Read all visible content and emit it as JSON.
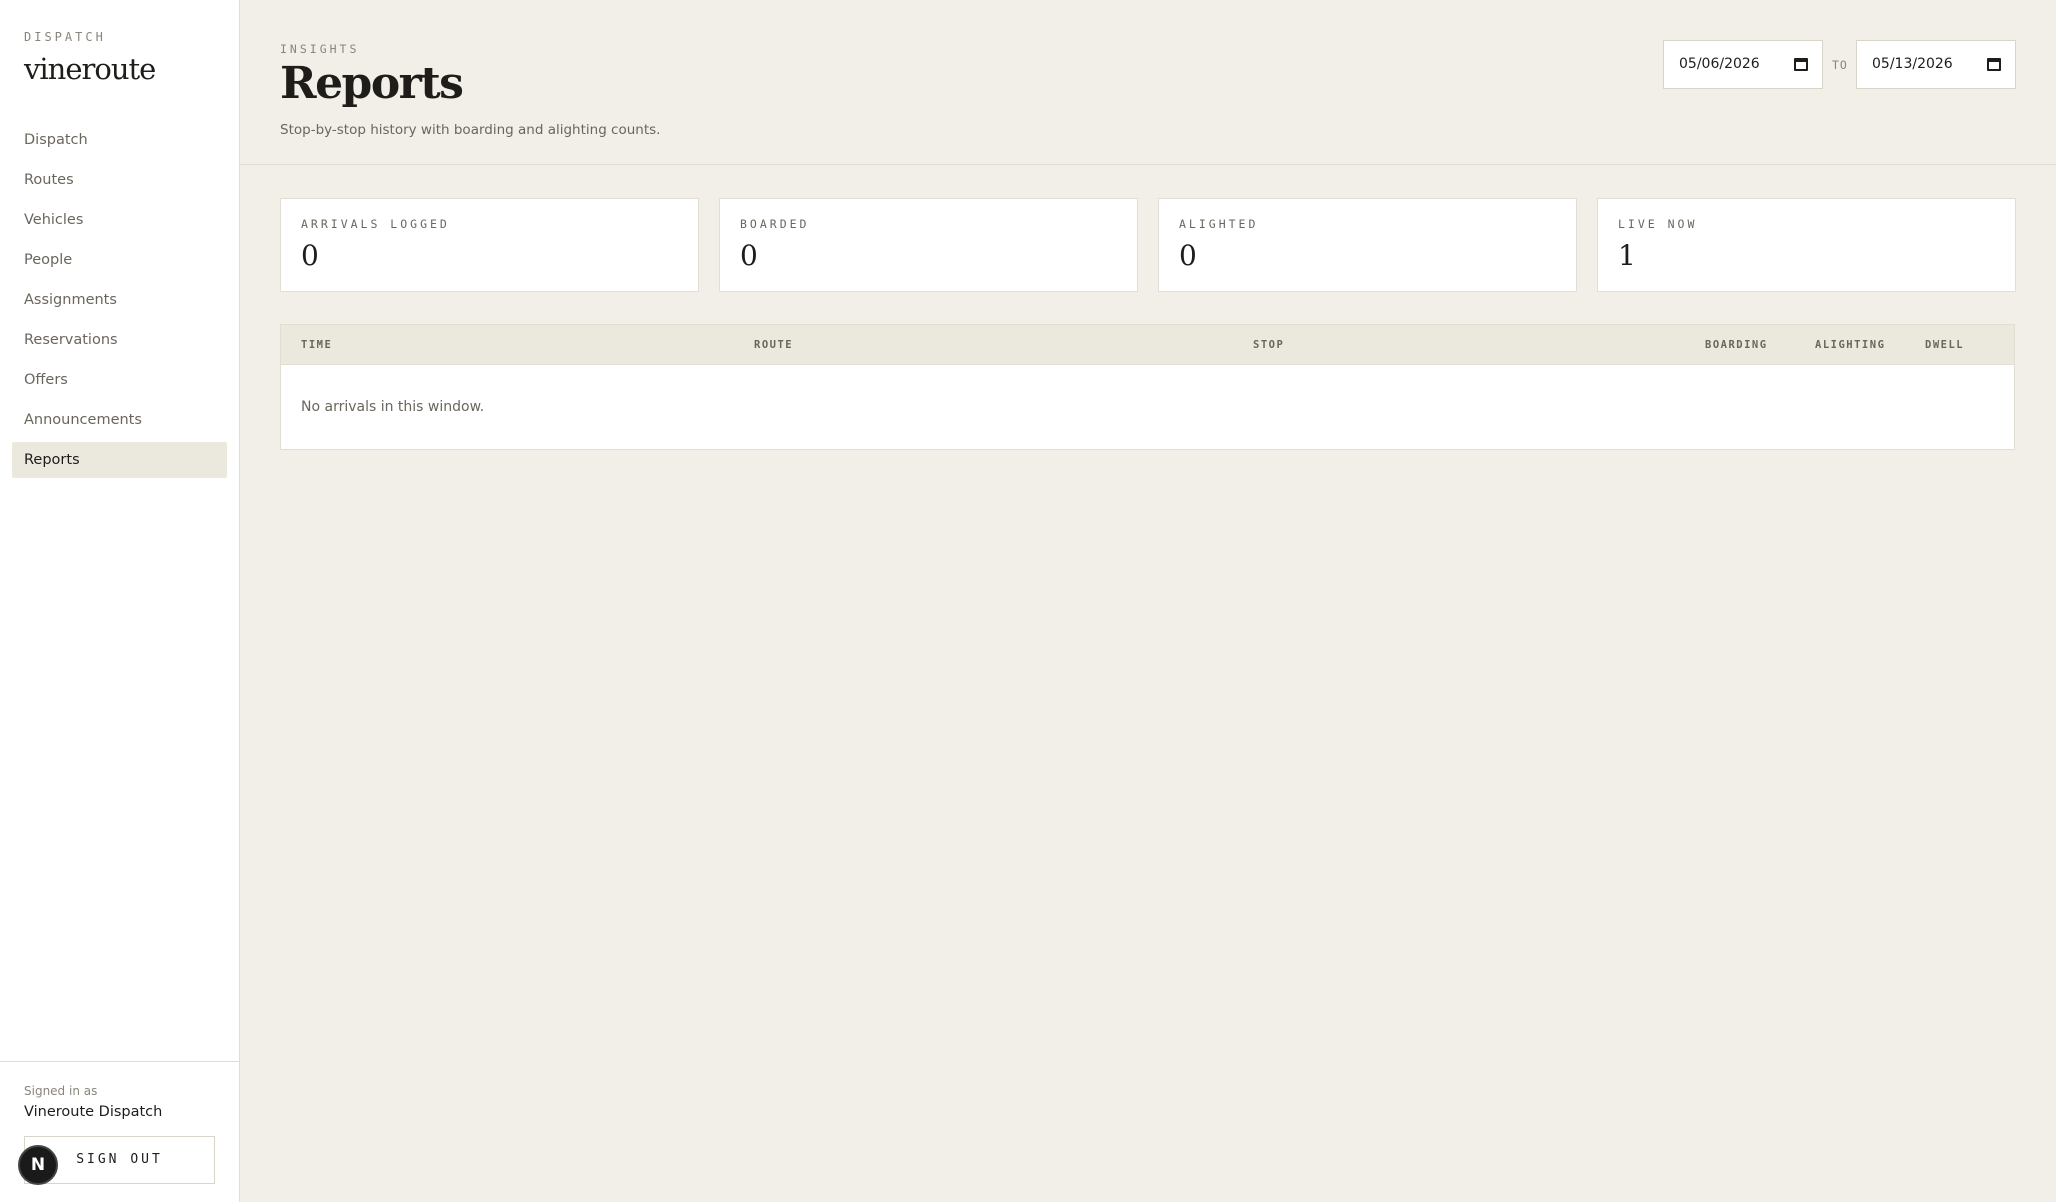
{
  "sidebar": {
    "eyebrow": "DISPATCH",
    "brand": "vineroute",
    "items": [
      {
        "label": "Dispatch"
      },
      {
        "label": "Routes"
      },
      {
        "label": "Vehicles"
      },
      {
        "label": "People"
      },
      {
        "label": "Assignments"
      },
      {
        "label": "Reservations"
      },
      {
        "label": "Offers"
      },
      {
        "label": "Announcements"
      },
      {
        "label": "Reports"
      }
    ],
    "active_item": "Reports",
    "footer": {
      "signed_in_label": "Signed in as",
      "user": "Vineroute Dispatch",
      "sign_out_label": "SIGN OUT"
    },
    "badge": "N"
  },
  "header": {
    "eyebrow": "INSIGHTS",
    "title": "Reports",
    "subtitle": "Stop-by-stop history with boarding and alighting counts.",
    "date_from": "05/06/2026",
    "to_label": "TO",
    "date_to": "05/13/2026"
  },
  "stats": [
    {
      "label": "ARRIVALS LOGGED",
      "value": "0"
    },
    {
      "label": "BOARDED",
      "value": "0"
    },
    {
      "label": "ALIGHTED",
      "value": "0"
    },
    {
      "label": "LIVE NOW",
      "value": "1"
    }
  ],
  "table": {
    "columns": [
      "TIME",
      "ROUTE",
      "STOP",
      "BOARDING",
      "ALIGHTING",
      "DWELL"
    ],
    "empty_message": "No arrivals in this window."
  },
  "colors": {
    "background": "#f2efe8",
    "sidebar": "#ffffff",
    "active_item": "#ebe8de",
    "text": "#1f1d1a",
    "muted": "#6b665d"
  }
}
